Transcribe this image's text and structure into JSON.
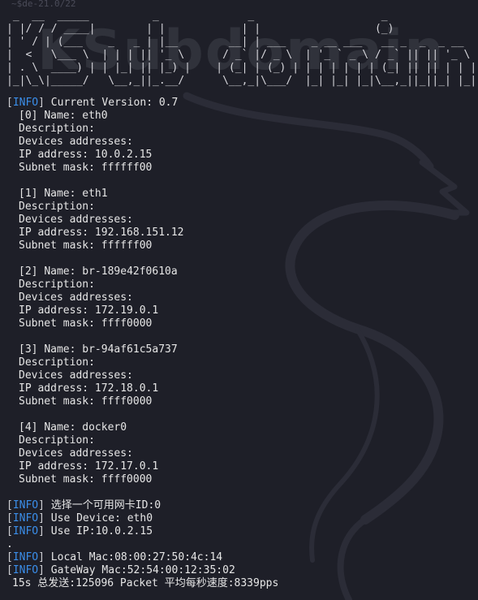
{
  "terminal": {
    "ghost_top": "~$de-21.0/22",
    "ghost_mid": "",
    "banner": {
      "ascii": " _  __  _____          _              _                    _\n| |/ / / ____|        | |            | |                  (_)\n| ' / | (___    _   _ | |__        __| | ___    _ __ ___   __ _  _  _ __\n|  <   \\___ \\  | | | || '_ \\      / _` |/ _ \\  | '_ ` _ \\ / _` || || '_ \\\n| . \\  ____) | | |_| || |_) |    | (_| | (_) | | | | | | | (_| || || | | |\n|_|\\_\\|_____/   \\__,_||_.__/      \\__,_|\\___/  |_| |_| |_|\\__,_||_||_| |_|",
      "watermark": "KSubdomain"
    },
    "tag_word": "INFO",
    "version_line": "Current Version: 0.7",
    "field_labels": {
      "name": "Name: ",
      "description": "Description:",
      "devices": "Devices addresses:",
      "ip": "IP address: ",
      "mask": "Subnet mask: "
    },
    "devices": [
      {
        "index": "[0]",
        "name": "eth0",
        "ip": "10.0.2.15",
        "mask": "ffffff00"
      },
      {
        "index": "[1]",
        "name": "eth1",
        "ip": "192.168.151.12",
        "mask": "ffffff00"
      },
      {
        "index": "[2]",
        "name": "br-189e42f0610a",
        "ip": "172.19.0.1",
        "mask": "ffff0000"
      },
      {
        "index": "[3]",
        "name": "br-94af61c5a737",
        "ip": "172.18.0.1",
        "mask": "ffff0000"
      },
      {
        "index": "[4]",
        "name": "docker0",
        "ip": "172.17.0.1",
        "mask": "ffff0000"
      }
    ],
    "info_lines_a": [
      "选择一个可用网卡ID:0",
      "Use Device: eth0",
      "Use IP:10.0.2.15"
    ],
    "dot_line": ".",
    "info_lines_b": [
      "Local Mac:08:00:27:50:4c:14",
      "GateWay Mac:52:54:00:12:35:02"
    ],
    "status_line": "15s 总发送:125096 Packet 平均每秒速度:8339pps"
  },
  "colors": {
    "background": "#1e1f28",
    "text": "#e6e6e6",
    "info_tag": "#3b8eea",
    "kali_dragon": "#2a2b35"
  },
  "icons": {
    "background_art": "kali-dragon-icon"
  }
}
